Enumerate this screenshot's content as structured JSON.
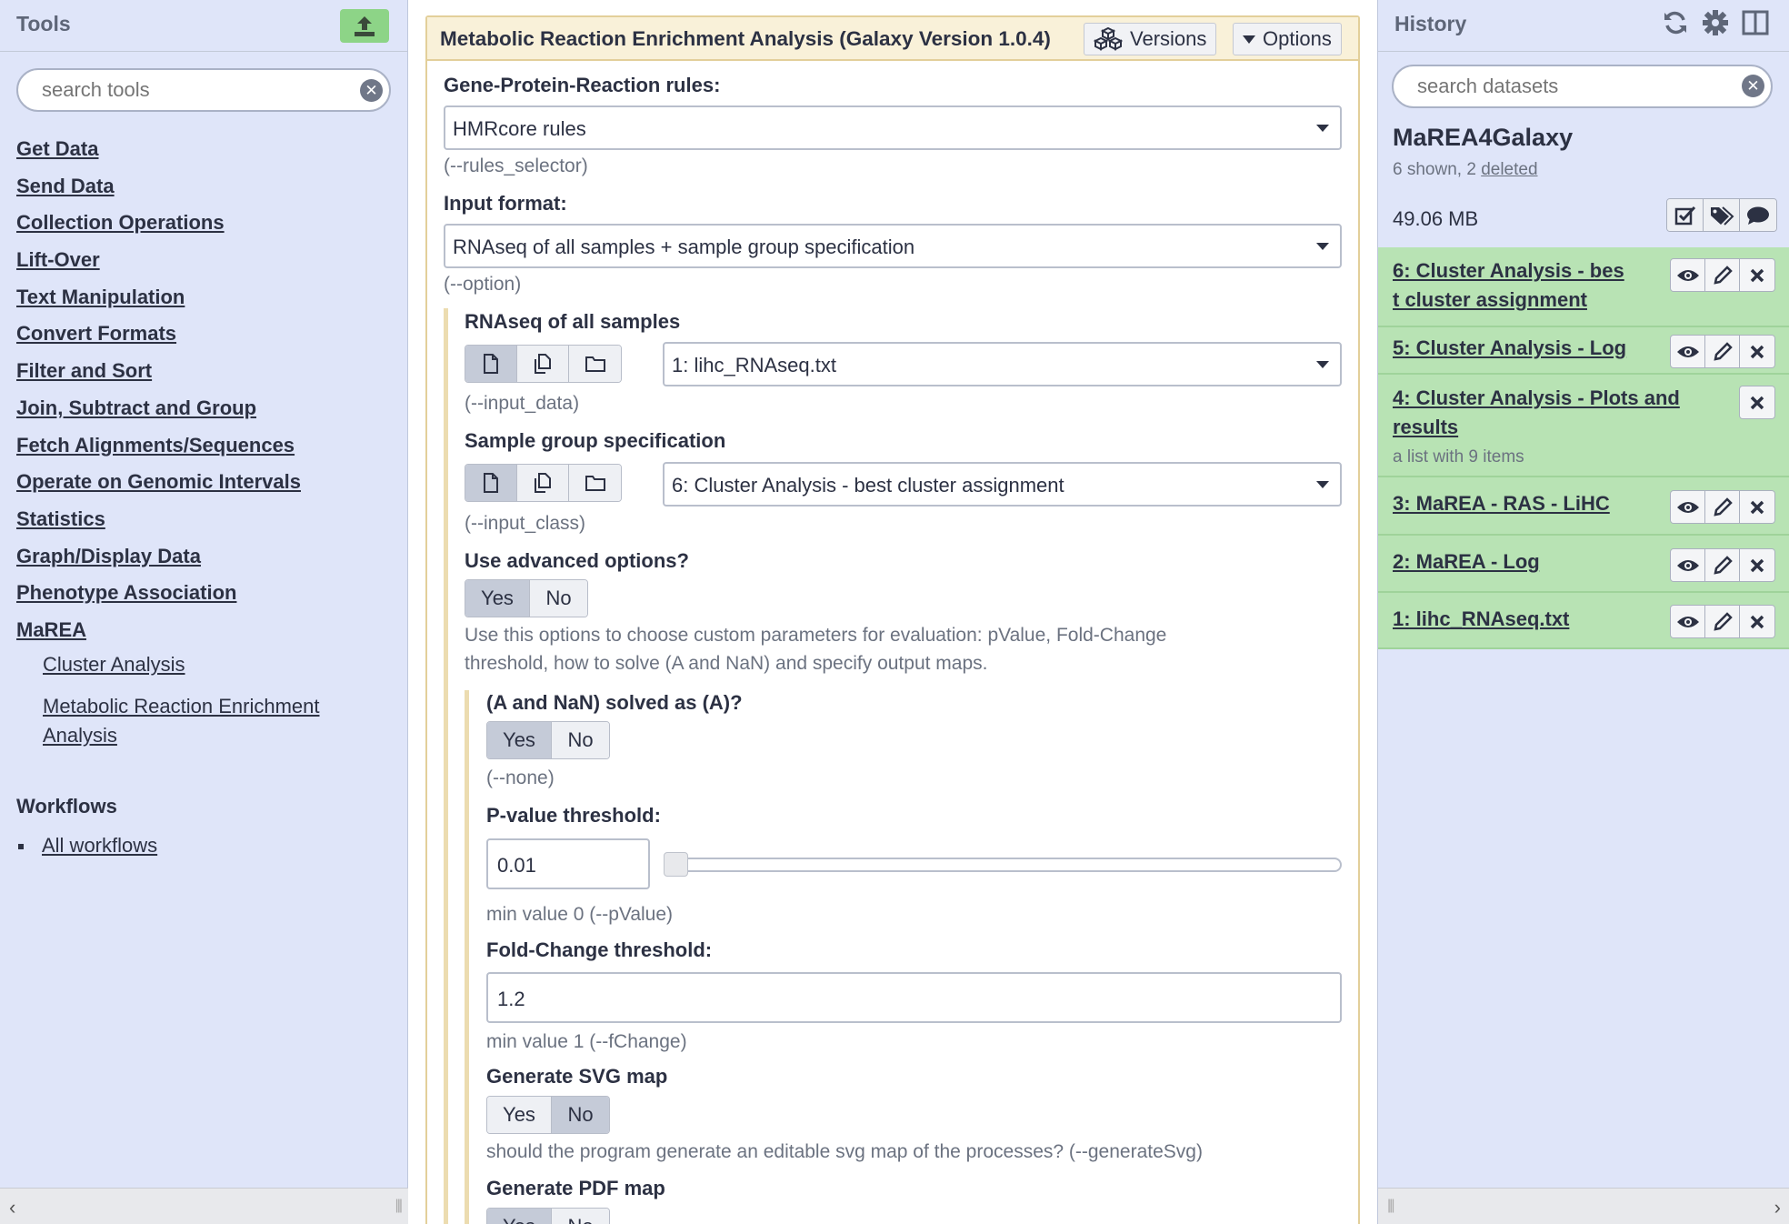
{
  "tools": {
    "title": "Tools",
    "search_placeholder": "search tools",
    "sections": [
      "Get Data",
      "Send Data",
      "Collection Operations",
      "Lift-Over",
      "Text Manipulation",
      "Convert Formats",
      "Filter and Sort",
      "Join, Subtract and Group",
      "Fetch Alignments/Sequences",
      "Operate on Genomic Intervals",
      "Statistics",
      "Graph/Display Data",
      "Phenotype Association",
      "MaREA"
    ],
    "marea_tools": [
      "Cluster Analysis",
      "Metabolic Reaction Enrichment",
      "Analysis"
    ],
    "workflows_title": "Workflows",
    "all_workflows": "All workflows"
  },
  "form": {
    "title": "Metabolic Reaction Enrichment Analysis (Galaxy Version 1.0.4)",
    "versions_label": "Versions",
    "options_label": "Options",
    "gpr_label": "Gene-Protein-Reaction rules:",
    "gpr_value": "HMRcore rules",
    "gpr_help": "(--rules_selector)",
    "input_format_label": "Input format:",
    "input_format_value": "RNAseq of all samples + sample group specification",
    "input_format_help": "(--option)",
    "rnaseq_label": "RNAseq of all samples",
    "rnaseq_value": "1: lihc_RNAseq.txt",
    "rnaseq_help": "(--input_data)",
    "group_label": "Sample group specification",
    "group_value": "6: Cluster Analysis - best cluster assignment",
    "group_help": "(--input_class)",
    "advanced_label": "Use advanced options?",
    "yes": "Yes",
    "no": "No",
    "advanced_help_1": "Use this options to choose custom parameters for evaluation: pValue, Fold-Change",
    "advanced_help_2": "threshold, how to solve (A and NaN) and specify output maps.",
    "nan_label": "(A and NaN) solved as (A)?",
    "nan_help": "(--none)",
    "pvalue_label": "P-value threshold:",
    "pvalue_value": "0.01",
    "pvalue_slider_fraction": 0.0,
    "pvalue_help": "min value 0 (--pValue)",
    "fc_label": "Fold-Change threshold:",
    "fc_value": "1.2",
    "fc_help": "min value 1 (--fChange)",
    "svg_label": "Generate SVG map",
    "svg_help": "should the program generate an editable svg map of the processes? (--generateSvg)",
    "pdf_label": "Generate PDF map"
  },
  "history": {
    "title": "History",
    "search_placeholder": "search datasets",
    "name": "MaREA4Galaxy",
    "shown": "6 shown, 2",
    "deleted": "deleted",
    "size": "49.06 MB",
    "datasets": [
      {
        "title_1": "6: Cluster Analysis - bes",
        "title_2": "t cluster assignment"
      },
      {
        "title_1": "5: Cluster Analysis - Log"
      },
      {
        "title_1": "4: Cluster Analysis - Plots and",
        "title_2": "results",
        "sub": "a list with 9 items"
      },
      {
        "title_1": "3: MaREA - RAS - LiHC"
      },
      {
        "title_1": "2: MaREA - Log"
      },
      {
        "title_1": "1: lihc_RNAseq.txt"
      }
    ]
  },
  "colors": {
    "panel_bg": "#dfe5f9",
    "dataset_ok": "#b8e3b4",
    "form_header": "#f9f1d9",
    "upload_btn": "#8dd487"
  },
  "icons": {
    "upload": "upload-icon",
    "refresh": "refresh-icon",
    "gear": "gear-icon",
    "columns": "columns-icon",
    "eye": "eye-icon",
    "pencil": "pencil-icon",
    "close": "close-icon"
  }
}
